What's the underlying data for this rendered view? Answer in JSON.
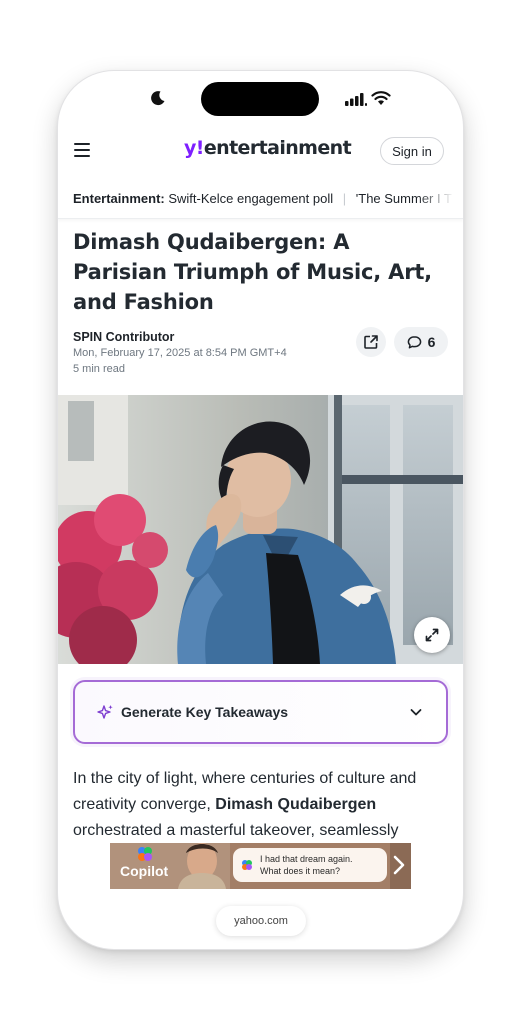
{
  "status_bar": {
    "focus_icon": "moon-icon",
    "signal_icon": "cellular-signal-icon",
    "wifi_icon": "wifi-icon"
  },
  "nav": {
    "menu_icon": "hamburger-menu-icon",
    "logo_y": "y!",
    "logo_text": "entertainment",
    "signin_label": "Sign in",
    "brand_color": "#7e1fff"
  },
  "trending": {
    "label": "Entertainment:",
    "items": [
      "Swift-Kelce engagement poll",
      "'The Summer I T"
    ]
  },
  "article": {
    "headline": "Dimash Qudaibergen: A Parisian Triumph of Music, Art, and Fashion",
    "author": "SPIN Contributor",
    "date": "Mon, February 17, 2025 at 8:54 PM GMT+4",
    "read_time": "5 min read",
    "share_icon": "share-icon",
    "comment_count": "6",
    "comment_icon": "comment-icon",
    "expand_icon": "expand-icon"
  },
  "takeaways": {
    "label": "Generate Key Takeaways",
    "icon": "sparkle-icon",
    "chevron": "chevron-down-icon",
    "accent_color": "#a56bd6"
  },
  "body": {
    "part1": "In the city of light, where centuries of culture and creativity converge, ",
    "bold": "Dimash Qudaibergen",
    "part2": " orchestrated a masterful takeover, seamlessly"
  },
  "ad": {
    "brand": "Copilot",
    "bubble_text": "I had that dream again. What does it mean?"
  },
  "browser": {
    "url": "yahoo.com"
  }
}
